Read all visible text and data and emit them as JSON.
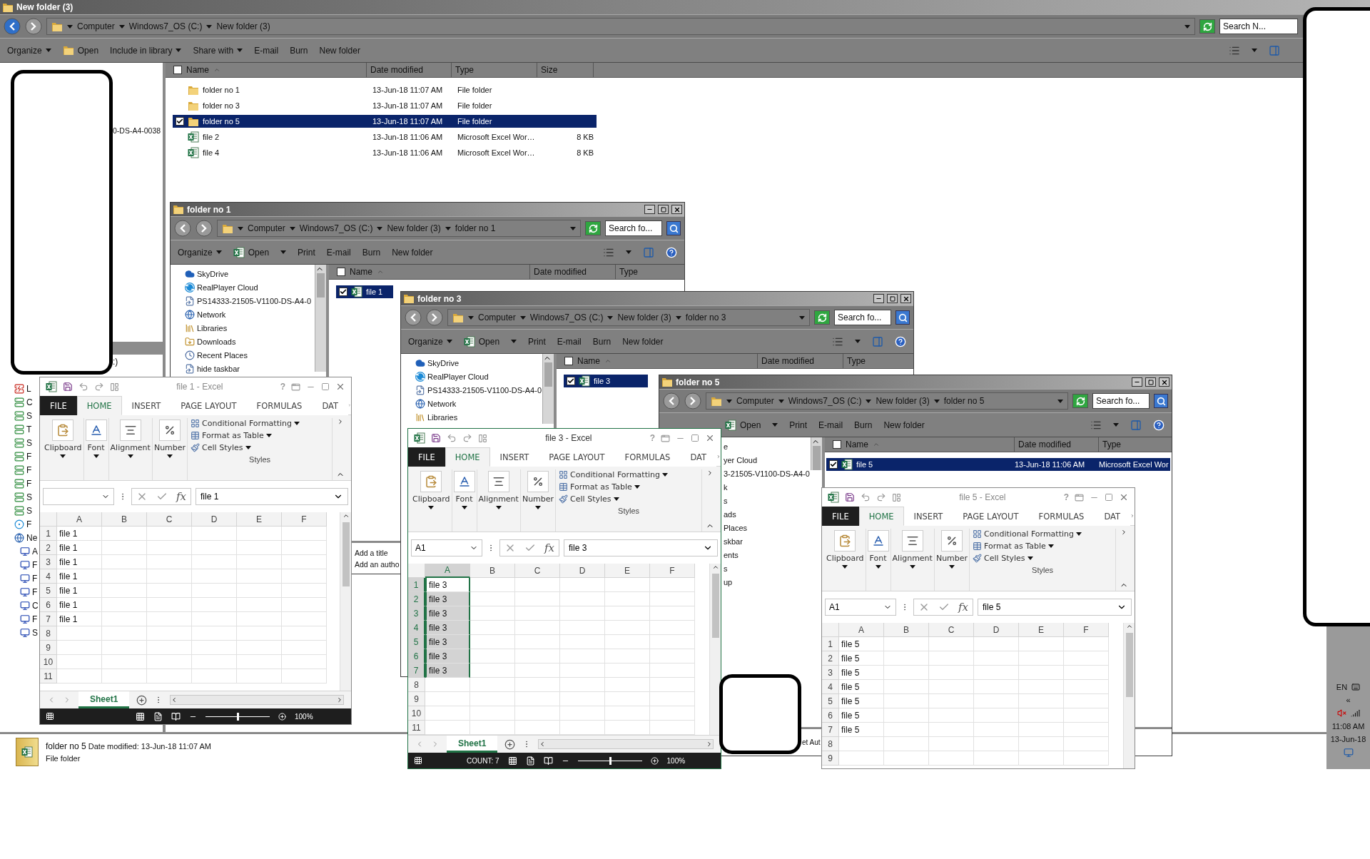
{
  "main_window": {
    "title": "New folder (3)",
    "back_enabled": true,
    "breadcrumb": [
      "Computer",
      "Windows7_OS (C:)",
      "New folder (3)"
    ],
    "search": {
      "placeholder": "Search N..."
    },
    "toolbar": [
      {
        "label": "Organize",
        "kind": "menu"
      },
      {
        "label": "Open",
        "kind": "open"
      },
      {
        "label": "Include in library",
        "kind": "menu"
      },
      {
        "label": "Share with",
        "kind": "menu"
      },
      {
        "label": "E-mail",
        "kind": "button"
      },
      {
        "label": "Burn",
        "kind": "button"
      },
      {
        "label": "New folder",
        "kind": "button"
      }
    ],
    "columns": [
      {
        "label": "Name",
        "sorted": true
      },
      {
        "label": "Date modified",
        "sorted": false
      },
      {
        "label": "Type",
        "sorted": false
      },
      {
        "label": "Size",
        "sorted": false
      }
    ],
    "rows": [
      {
        "name": "folder no 1",
        "kind": "folder",
        "date": "13-Jun-18 11:07 AM",
        "type": "File folder",
        "selected": false
      },
      {
        "name": "folder no 3",
        "kind": "folder",
        "date": "13-Jun-18 11:07 AM",
        "type": "File folder",
        "selected": false
      },
      {
        "name": "folder no 5",
        "kind": "folder",
        "date": "13-Jun-18 11:07 AM",
        "type": "File folder",
        "selected": true
      },
      {
        "name": "file 2",
        "kind": "excel",
        "date": "13-Jun-18 11:06 AM",
        "type": "Microsoft Excel Wor…",
        "size": "8 KB",
        "selected": false
      },
      {
        "name": "file 4",
        "kind": "excel",
        "date": "13-Jun-18 11:06 AM",
        "type": "Microsoft Excel Wor…",
        "size": "8 KB",
        "selected": false
      }
    ],
    "nav_items": [
      {
        "label": "0-DS-A4-0038"
      },
      {
        "label": ":)"
      },
      {
        "label": "L",
        "kind": "netdrive-error"
      },
      {
        "label": "C",
        "kind": "netdrive"
      },
      {
        "label": "S",
        "kind": "netdrive"
      },
      {
        "label": "T",
        "kind": "netdrive"
      },
      {
        "label": "S",
        "kind": "netdrive"
      },
      {
        "label": "F",
        "kind": "netdrive"
      },
      {
        "label": "F",
        "kind": "netdrive"
      },
      {
        "label": "F",
        "kind": "netdrive"
      },
      {
        "label": "S",
        "kind": "netdrive"
      },
      {
        "label": "S",
        "kind": "netdrive"
      },
      {
        "label": "F",
        "kind": "homegroup"
      },
      {
        "label": "Ne",
        "kind": "network",
        "children": [
          {
            "label": "A",
            "kind": "computer"
          },
          {
            "label": "F",
            "kind": "computer"
          },
          {
            "label": "F",
            "kind": "computer"
          },
          {
            "label": "F",
            "kind": "computer"
          },
          {
            "label": "C",
            "kind": "computer"
          },
          {
            "label": "F",
            "kind": "computer"
          },
          {
            "label": "S",
            "kind": "computer"
          }
        ]
      }
    ],
    "details": {
      "name": "folder no 5",
      "label": "Date modified:",
      "value": "13-Jun-18 11:07 AM",
      "type": "File folder"
    }
  },
  "explorer_windows": [
    {
      "title": "folder no 1",
      "back_enabled": false,
      "breadcrumb": [
        "Computer",
        "Windows7_OS (C:)",
        "New folder (3)",
        "folder no 1"
      ],
      "search": {
        "placeholder": "Search fo..."
      },
      "toolbar": [
        {
          "label": "Organize",
          "kind": "menu"
        },
        {
          "label": "Open",
          "kind": "excel-open"
        },
        {
          "label": "Print",
          "kind": "button"
        },
        {
          "label": "E-mail",
          "kind": "button"
        },
        {
          "label": "Burn",
          "kind": "button"
        },
        {
          "label": "New folder",
          "kind": "button"
        }
      ],
      "columns": [
        {
          "label": "Name",
          "sorted": true
        },
        {
          "label": "Date modified",
          "sorted": false
        },
        {
          "label": "Type",
          "sorted": false
        }
      ],
      "rows": [
        {
          "name": "file 1",
          "kind": "excel",
          "selected": true
        }
      ],
      "nav_items": [
        {
          "label": "SkyDrive",
          "kind": "skydrive"
        },
        {
          "label": "RealPlayer Cloud",
          "kind": "realplayer"
        },
        {
          "label": "PS14333-21505-V1100-DS-A4-0",
          "kind": "shortcut"
        },
        {
          "label": "Network",
          "kind": "network"
        },
        {
          "label": "Libraries",
          "kind": "libraries"
        },
        {
          "label": "Downloads",
          "kind": "downloads"
        },
        {
          "label": "Recent Places",
          "kind": "recent"
        },
        {
          "label": "hide taskbar",
          "kind": "shortcut"
        }
      ],
      "details_lines": [
        "Add a title",
        "Add an autho"
      ]
    },
    {
      "title": "folder no 3",
      "back_enabled": false,
      "breadcrumb": [
        "Computer",
        "Windows7_OS (C:)",
        "New folder (3)",
        "folder no 3"
      ],
      "search": {
        "placeholder": "Search fo..."
      },
      "toolbar": [
        {
          "label": "Organize",
          "kind": "menu"
        },
        {
          "label": "Open",
          "kind": "excel-open"
        },
        {
          "label": "Print",
          "kind": "button"
        },
        {
          "label": "E-mail",
          "kind": "button"
        },
        {
          "label": "Burn",
          "kind": "button"
        },
        {
          "label": "New folder",
          "kind": "button"
        }
      ],
      "columns": [
        {
          "label": "Name",
          "sorted": true
        },
        {
          "label": "Date modified",
          "sorted": false
        },
        {
          "label": "Type",
          "sorted": false
        }
      ],
      "rows": [
        {
          "name": "file 3",
          "kind": "excel",
          "selected": true
        }
      ],
      "nav_items": [
        {
          "label": "SkyDrive",
          "kind": "skydrive"
        },
        {
          "label": "RealPlayer Cloud",
          "kind": "realplayer"
        },
        {
          "label": "PS14333-21505-V1100-DS-A4-0",
          "kind": "shortcut"
        },
        {
          "label": "Network",
          "kind": "network"
        },
        {
          "label": "Libraries",
          "kind": "libraries"
        }
      ]
    },
    {
      "title": "folder no 5",
      "back_enabled": false,
      "breadcrumb": [
        "Computer",
        "Windows7_OS (C:)",
        "New folder (3)",
        "folder no 5"
      ],
      "search": {
        "placeholder": "Search fo..."
      },
      "toolbar": [
        {
          "label": "Open",
          "kind": "excel-open"
        },
        {
          "label": "Print",
          "kind": "button"
        },
        {
          "label": "E-mail",
          "kind": "button"
        },
        {
          "label": "Burn",
          "kind": "button"
        },
        {
          "label": "New folder",
          "kind": "button"
        }
      ],
      "columns": [
        {
          "label": "Name",
          "sorted": true
        },
        {
          "label": "Date modified",
          "sorted": false
        },
        {
          "label": "Type",
          "sorted": false
        }
      ],
      "rows": [
        {
          "name": "file 5",
          "kind": "excel",
          "date": "13-Jun-18 11:06 AM",
          "type": "Microsoft Excel Wor",
          "selected": true
        }
      ],
      "nav_items": [
        {
          "label": "e"
        },
        {
          "label": "yer Cloud"
        },
        {
          "label": "3-21505-V1100-DS-A4-0"
        },
        {
          "label": "k"
        },
        {
          "label": "s"
        },
        {
          "label": "ads"
        },
        {
          "label": "Places"
        },
        {
          "label": "skbar"
        },
        {
          "label": "ents"
        },
        {
          "label": "s"
        },
        {
          "label": "up"
        }
      ],
      "details_lines": [
        "et Aut"
      ]
    }
  ],
  "excel_windows": [
    {
      "title": "file 1 - Excel",
      "active": false,
      "help": "?",
      "tabs": [
        {
          "label": "FILE",
          "kind": "backstage",
          "selected": false
        },
        {
          "label": "HOME",
          "kind": "tab",
          "selected": true
        },
        {
          "label": "INSERT",
          "kind": "tab",
          "selected": false
        },
        {
          "label": "PAGE LAYOUT",
          "kind": "tab",
          "selected": false
        },
        {
          "label": "FORMULAS",
          "kind": "tab",
          "selected": false
        },
        {
          "label": "DAT",
          "kind": "tab",
          "selected": false
        }
      ],
      "ribbon": [
        {
          "label": "Clipboard",
          "kind": "paste"
        },
        {
          "label": "Font",
          "kind": "font"
        },
        {
          "label": "Alignment",
          "kind": "align"
        },
        {
          "label": "Number",
          "kind": "percent"
        }
      ],
      "styles": {
        "items": [
          "Conditional Formatting",
          "Format as Table",
          "Cell Styles"
        ],
        "label": "Styles"
      },
      "function_label": "fx",
      "formula": "file 1",
      "columns": [
        {
          "label": "A",
          "selected": false
        },
        {
          "label": "B",
          "selected": false
        },
        {
          "label": "C",
          "selected": false
        },
        {
          "label": "D",
          "selected": false
        },
        {
          "label": "E",
          "selected": false
        },
        {
          "label": "F",
          "selected": false
        }
      ],
      "rows": [
        {
          "number": "1",
          "value": "file 1",
          "selected": false
        },
        {
          "number": "2",
          "value": "file 1",
          "selected": false
        },
        {
          "number": "3",
          "value": "file 1",
          "selected": false
        },
        {
          "number": "4",
          "value": "file 1",
          "selected": false
        },
        {
          "number": "5",
          "value": "file 1",
          "selected": false
        },
        {
          "number": "6",
          "value": "file 1",
          "selected": false
        },
        {
          "number": "7",
          "value": "file 1",
          "selected": false
        },
        {
          "number": "8",
          "selected": false
        },
        {
          "number": "9",
          "selected": false
        },
        {
          "number": "10",
          "selected": false
        },
        {
          "number": "11",
          "selected": false
        }
      ],
      "sheet_tab": "Sheet1",
      "status": {
        "zoom": "100%",
        "level": 0.5
      }
    },
    {
      "title": "file 3 - Excel",
      "active": true,
      "help": "?",
      "tabs": [
        {
          "label": "FILE",
          "kind": "backstage",
          "selected": false
        },
        {
          "label": "HOME",
          "kind": "tab",
          "selected": true
        },
        {
          "label": "INSERT",
          "kind": "tab",
          "selected": false
        },
        {
          "label": "PAGE LAYOUT",
          "kind": "tab",
          "selected": false
        },
        {
          "label": "FORMULAS",
          "kind": "tab",
          "selected": false
        },
        {
          "label": "DAT",
          "kind": "tab",
          "selected": false
        }
      ],
      "ribbon": [
        {
          "label": "Clipboard",
          "kind": "paste"
        },
        {
          "label": "Font",
          "kind": "font"
        },
        {
          "label": "Alignment",
          "kind": "align"
        },
        {
          "label": "Number",
          "kind": "percent"
        }
      ],
      "styles": {
        "items": [
          "Conditional Formatting",
          "Format as Table",
          "Cell Styles"
        ],
        "label": "Styles"
      },
      "name_box": "A1",
      "function_label": "fx",
      "formula": "file 3",
      "columns": [
        {
          "label": "A",
          "selected": true
        },
        {
          "label": "B",
          "selected": false
        },
        {
          "label": "C",
          "selected": false
        },
        {
          "label": "D",
          "selected": false
        },
        {
          "label": "E",
          "selected": false
        },
        {
          "label": "F",
          "selected": false
        }
      ],
      "rows": [
        {
          "number": "1",
          "value": "file 3",
          "selected": true,
          "current": true
        },
        {
          "number": "2",
          "value": "file 3",
          "selected": true
        },
        {
          "number": "3",
          "value": "file 3",
          "selected": true
        },
        {
          "number": "4",
          "value": "file 3",
          "selected": true
        },
        {
          "number": "5",
          "value": "file 3",
          "selected": true
        },
        {
          "number": "6",
          "value": "file 3",
          "selected": true
        },
        {
          "number": "7",
          "value": "file 3",
          "selected": true
        },
        {
          "number": "8",
          "selected": false
        },
        {
          "number": "9",
          "selected": false
        },
        {
          "number": "10",
          "selected": false
        },
        {
          "number": "11",
          "selected": false
        }
      ],
      "sheet_tab": "Sheet1",
      "status": {
        "text": "COUNT: 7",
        "zoom": "100%",
        "level": 0.5
      }
    },
    {
      "title": "file 5 - Excel",
      "active": false,
      "help": "?",
      "tabs": [
        {
          "label": "FILE",
          "kind": "backstage",
          "selected": false
        },
        {
          "label": "HOME",
          "kind": "tab",
          "selected": true
        },
        {
          "label": "INSERT",
          "kind": "tab",
          "selected": false
        },
        {
          "label": "PAGE LAYOUT",
          "kind": "tab",
          "selected": false
        },
        {
          "label": "FORMULAS",
          "kind": "tab",
          "selected": false
        },
        {
          "label": "DAT",
          "kind": "tab",
          "selected": false
        }
      ],
      "ribbon": [
        {
          "label": "Clipboard",
          "kind": "paste"
        },
        {
          "label": "Font",
          "kind": "font"
        },
        {
          "label": "Alignment",
          "kind": "align"
        },
        {
          "label": "Number",
          "kind": "percent"
        }
      ],
      "styles": {
        "items": [
          "Conditional Formatting",
          "Format as Table",
          "Cell Styles"
        ],
        "label": "Styles"
      },
      "name_box": "A1",
      "function_label": "fx",
      "formula": "file 5",
      "columns": [
        {
          "label": "A",
          "selected": false
        },
        {
          "label": "B",
          "selected": false
        },
        {
          "label": "C",
          "selected": false
        },
        {
          "label": "D",
          "selected": false
        },
        {
          "label": "E",
          "selected": false
        },
        {
          "label": "F",
          "selected": false
        }
      ],
      "rows": [
        {
          "number": "1",
          "value": "file 5",
          "selected": false
        },
        {
          "number": "2",
          "value": "file 5",
          "selected": false
        },
        {
          "number": "3",
          "value": "file 5",
          "selected": false
        },
        {
          "number": "4",
          "value": "file 5",
          "selected": false
        },
        {
          "number": "5",
          "value": "file 5",
          "selected": false
        },
        {
          "number": "6",
          "value": "file 5",
          "selected": false
        },
        {
          "number": "7",
          "value": "file 5",
          "selected": false
        },
        {
          "number": "8",
          "selected": false
        },
        {
          "number": "9",
          "selected": false
        }
      ]
    }
  ],
  "taskbar": {
    "language": "EN",
    "expand": "«",
    "time": "11:08 AM",
    "date": "13-Jun-18"
  },
  "redactions": [
    {
      "kind": "box"
    },
    {
      "kind": "box"
    },
    {
      "kind": "box"
    }
  ]
}
